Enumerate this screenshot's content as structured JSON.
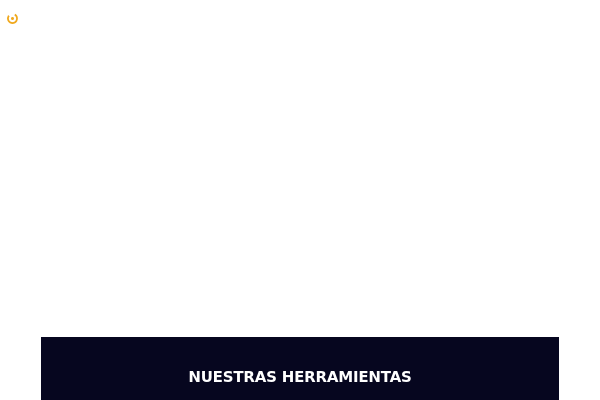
{
  "header": {
    "logo_text": "",
    "logo_icon": "circle-power-icon",
    "logo_color": "#f0a81c"
  },
  "tools_section": {
    "title": "NUESTRAS HERRAMIENTAS",
    "background_color": "#06061f",
    "text_color": "#ffffff"
  }
}
